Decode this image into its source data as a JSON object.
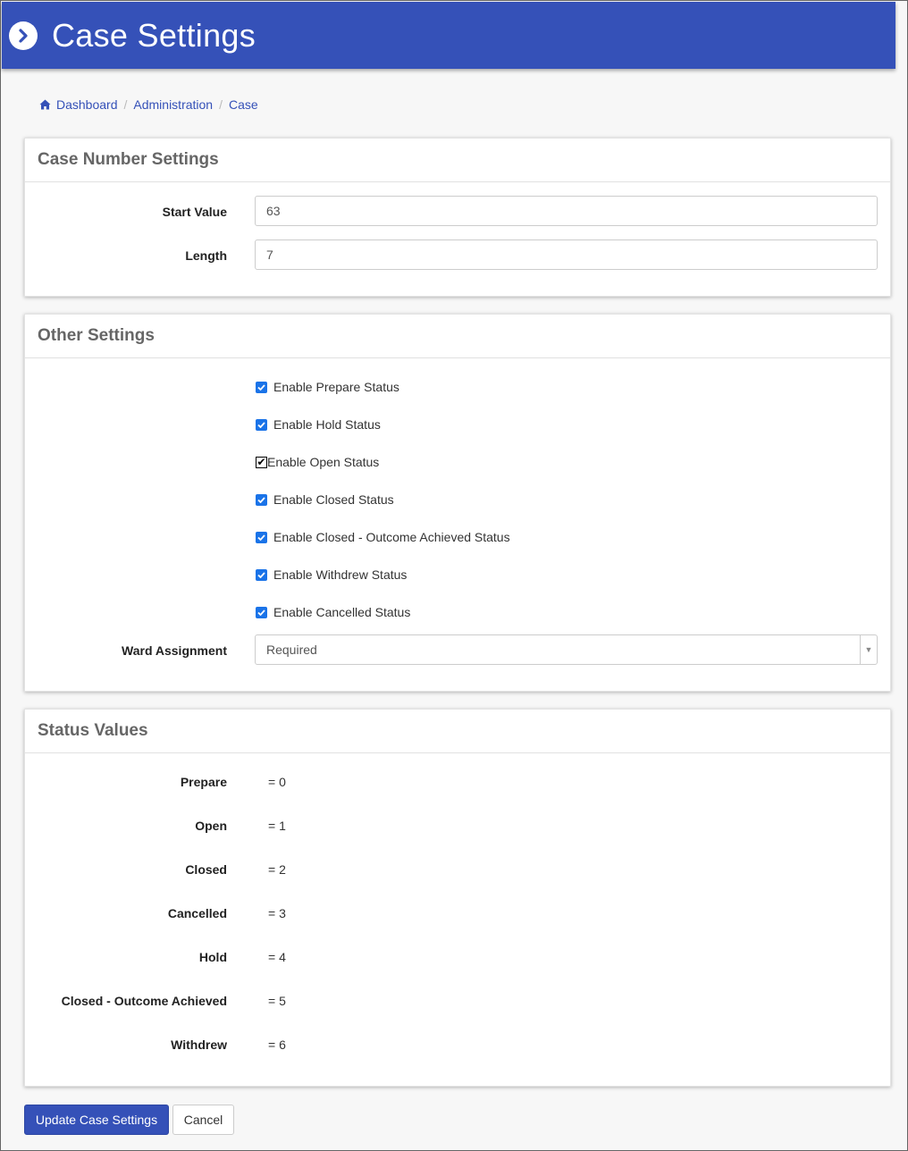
{
  "header": {
    "title": "Case Settings",
    "icon": "chevron-right-circle-icon"
  },
  "breadcrumb": {
    "items": [
      "Dashboard",
      "Administration",
      "Case"
    ],
    "home_icon": "home-icon"
  },
  "case_number_settings": {
    "title": "Case Number Settings",
    "start_value": {
      "label": "Start Value",
      "value": "63"
    },
    "length": {
      "label": "Length",
      "value": "7"
    }
  },
  "other_settings": {
    "title": "Other Settings",
    "checkboxes": [
      {
        "label": "Enable Prepare Status",
        "checked": true
      },
      {
        "label": "Enable Hold Status",
        "checked": true
      },
      {
        "label": "Enable Open Status",
        "checked": true
      },
      {
        "label": "Enable Closed Status",
        "checked": true
      },
      {
        "label": "Enable Closed - Outcome Achieved Status",
        "checked": true
      },
      {
        "label": "Enable Withdrew Status",
        "checked": true
      },
      {
        "label": "Enable Cancelled Status",
        "checked": true
      }
    ],
    "ward_assignment": {
      "label": "Ward Assignment",
      "value": "Required"
    }
  },
  "status_values": {
    "title": "Status Values",
    "items": [
      {
        "label": "Prepare",
        "value": "= 0"
      },
      {
        "label": "Open",
        "value": "= 1"
      },
      {
        "label": "Closed",
        "value": "= 2"
      },
      {
        "label": "Cancelled",
        "value": "= 3"
      },
      {
        "label": "Hold",
        "value": "= 4"
      },
      {
        "label": "Closed - Outcome Achieved",
        "value": "= 5"
      },
      {
        "label": "Withdrew",
        "value": "= 6"
      }
    ]
  },
  "actions": {
    "update_label": "Update Case Settings",
    "cancel_label": "Cancel"
  },
  "colors": {
    "primary": "#3551b8",
    "checkbox": "#1a73e8"
  }
}
